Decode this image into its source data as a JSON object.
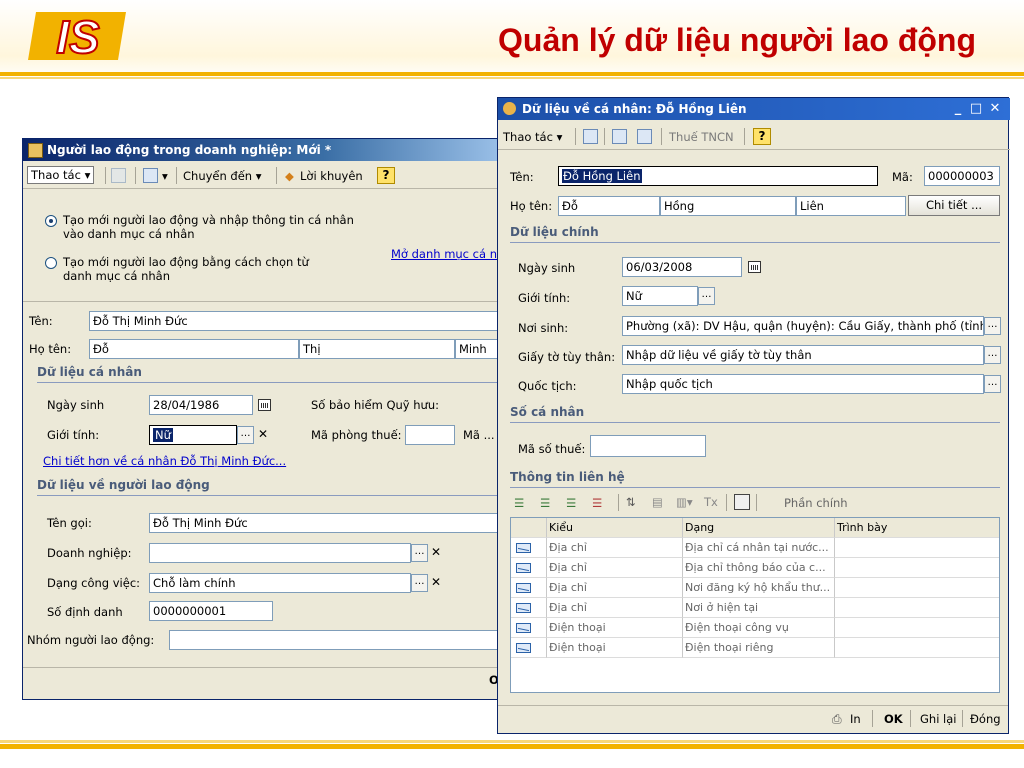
{
  "slide": {
    "title": "Quản lý dữ liệu người lao động",
    "logo_text": "IS",
    "accent_red": "#c00000",
    "accent_yellow": "#f2b200"
  },
  "left_window": {
    "title": "Người lao động trong doanh nghiệp: Mới *",
    "toolbar": {
      "actions": "Thao tác",
      "goto": "Chuyển đến",
      "advice": "Lời khuyên",
      "help": "?"
    },
    "radio1": "Tạo mới người lao động và nhập thông tin cá nhân vào danh mục cá nhân",
    "radio2": "Tạo mới người lao động bằng cách chọn từ danh mục cá nhân",
    "open_catalog_link": "Mở danh mục cá n",
    "name_label": "Tên:",
    "name_value": "Đỗ Thị Minh Đức",
    "fullname_label": "Họ tên:",
    "last_name": "Đỗ",
    "middle_name": "Thị",
    "first_name": "Minh",
    "personal_section": "Dữ liệu cá nhân",
    "dob_label": "Ngày sinh",
    "dob_value": "28/04/1986",
    "insurance_label": "Số bảo hiểm Quỹ hưu:",
    "gender_label": "Giới tính:",
    "gender_value": "Nữ",
    "tax_office_label": "Mã phòng thuế:",
    "code_label": "Mã ...",
    "detail_link": "Chi tiết hơn về cá nhân Đỗ Thị Minh Đức...",
    "employee_section": "Dữ liệu về người lao động",
    "callname_label": "Tên gọi:",
    "callname_value": "Đỗ Thị Minh Đức",
    "company_label": "Doanh nghiệp:",
    "company_value": "",
    "worktype_label": "Dạng công việc:",
    "worktype_value": "Chỗ làm chính",
    "id_label": "Số định danh",
    "id_value": "0000000001",
    "group_label": "Nhóm người lao động:",
    "group_value": "",
    "status_cut": "O"
  },
  "right_window": {
    "title": "Dữ liệu về cá nhân: Đỗ Hồng Liên",
    "toolbar": {
      "actions": "Thao tác",
      "tax": "Thuế TNCN",
      "help": "?"
    },
    "name_label": "Tên:",
    "name_value": "Đỗ Hồng Liên",
    "code_label": "Mã:",
    "code_value": "000000003",
    "fullname_label": "Họ tên:",
    "last_name": "Đỗ",
    "middle_name": "Hồng",
    "first_name": "Liên",
    "detail_button": "Chi tiết ...",
    "main_section": "Dữ liệu chính",
    "dob_label": "Ngày sinh",
    "dob_value": "06/03/2008",
    "gender_label": "Giới tính:",
    "gender_value": "Nữ",
    "birthplace_label": "Nơi sinh:",
    "birthplace_value": "Phường (xã): DV Hậu, quận (huyện): Cầu Giấy, thành phố (tỉnh):",
    "idpaper_label": "Giấy tờ tùy thân:",
    "idpaper_value": "Nhập dữ liệu về giấy tờ tùy thân",
    "nationality_label": "Quốc tịch:",
    "nationality_value": "Nhập quốc tịch",
    "personal_number_section": "Số cá nhân",
    "taxcode_label": "Mã số thuế:",
    "taxcode_value": "",
    "contact_section": "Thông tin liên hệ",
    "contact_toolbar_main": "Phần chính",
    "contact_columns": [
      "Kiểu",
      "Dạng",
      "Trình bày"
    ],
    "contacts": [
      {
        "type": "Địa chỉ",
        "form": "Địa chỉ cá nhân tại nước...",
        "display": ""
      },
      {
        "type": "Địa chỉ",
        "form": "Địa chỉ thông báo của c...",
        "display": ""
      },
      {
        "type": "Địa chỉ",
        "form": "Nơi đăng ký hộ khẩu thư...",
        "display": ""
      },
      {
        "type": "Địa chỉ",
        "form": "Nơi ở hiện tại",
        "display": ""
      },
      {
        "type": "Điện thoại",
        "form": "Điện thoại công vụ",
        "display": ""
      },
      {
        "type": "Điện thoại",
        "form": "Điện thoại riêng",
        "display": ""
      }
    ],
    "footer": {
      "print": "In",
      "ok": "OK",
      "save": "Ghi lại",
      "close": "Đóng"
    }
  }
}
